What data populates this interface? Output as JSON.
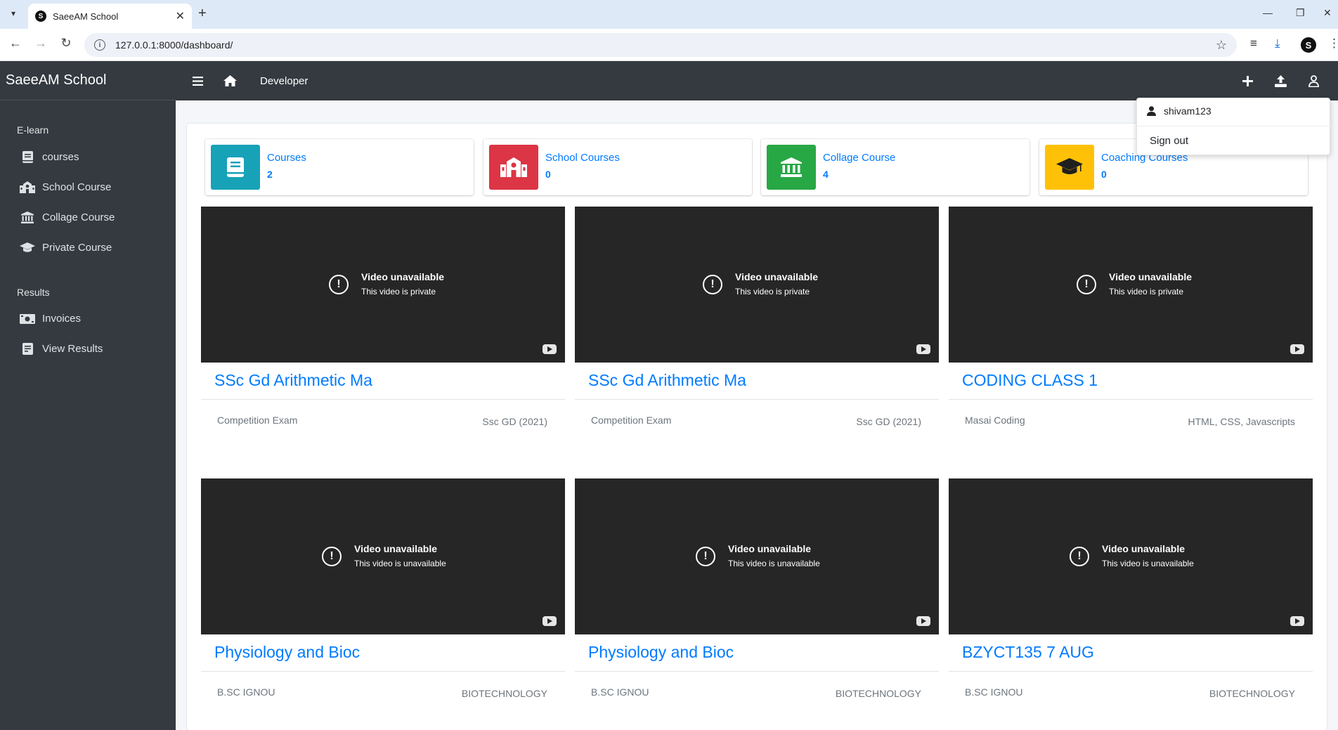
{
  "browser": {
    "tab_title": "SaeeAM School",
    "favicon_letter": "S",
    "url": "127.0.0.1:8000/dashboard/",
    "profile_letter": "S"
  },
  "app": {
    "brand": "SaeeAM School",
    "topbar": {
      "breadcrumb": "Developer"
    },
    "sidebar": {
      "sections": [
        {
          "label": "E-learn",
          "items": [
            {
              "label": "courses",
              "icon": "book-icon"
            },
            {
              "label": "School Course",
              "icon": "school-icon"
            },
            {
              "label": "Collage Course",
              "icon": "university-icon"
            },
            {
              "label": "Private Course",
              "icon": "graduation-cap-icon"
            }
          ]
        },
        {
          "label": "Results",
          "items": [
            {
              "label": "Invoices",
              "icon": "money-bill-icon"
            },
            {
              "label": "View Results",
              "icon": "receipt-icon"
            }
          ]
        }
      ]
    },
    "stats": [
      {
        "label": "Courses",
        "value": "2",
        "color": "#17a2b8",
        "icon": "book-icon"
      },
      {
        "label": "School Courses",
        "value": "0",
        "color": "#dc3545",
        "icon": "school-icon"
      },
      {
        "label": "Collage Course",
        "value": "4",
        "color": "#28a745",
        "icon": "university-icon"
      },
      {
        "label": "Coaching Courses",
        "value": "0",
        "color": "#ffc107",
        "icon": "graduation-cap-icon"
      }
    ],
    "courses": [
      {
        "title": "SSc Gd Arithmetic Ma",
        "category": "Competition Exam",
        "subject": "Ssc GD (2021)",
        "video_title": "Video unavailable",
        "video_sub": "This video is private"
      },
      {
        "title": "SSc Gd Arithmetic Ma",
        "category": "Competition Exam",
        "subject": "Ssc GD (2021)",
        "video_title": "Video unavailable",
        "video_sub": "This video is private"
      },
      {
        "title": "CODING CLASS 1",
        "category": "Masai Coding",
        "subject": "HTML, CSS, Javascripts",
        "video_title": "Video unavailable",
        "video_sub": "This video is private"
      },
      {
        "title": "Physiology and  Bioc",
        "category": "B.SC IGNOU",
        "subject": "BIOTECHNOLOGY",
        "video_title": "Video unavailable",
        "video_sub": "This video is unavailable"
      },
      {
        "title": "Physiology and Bioc",
        "category": "B.SC IGNOU",
        "subject": "BIOTECHNOLOGY",
        "video_title": "Video unavailable",
        "video_sub": "This video is unavailable"
      },
      {
        "title": "BZYCT135 7 AUG",
        "category": "B.SC IGNOU",
        "subject": "BIOTECHNOLOGY",
        "video_title": "Video unavailable",
        "video_sub": "This video is unavailable"
      }
    ],
    "user_menu": {
      "username": "shivam123",
      "signout": "Sign out"
    }
  }
}
